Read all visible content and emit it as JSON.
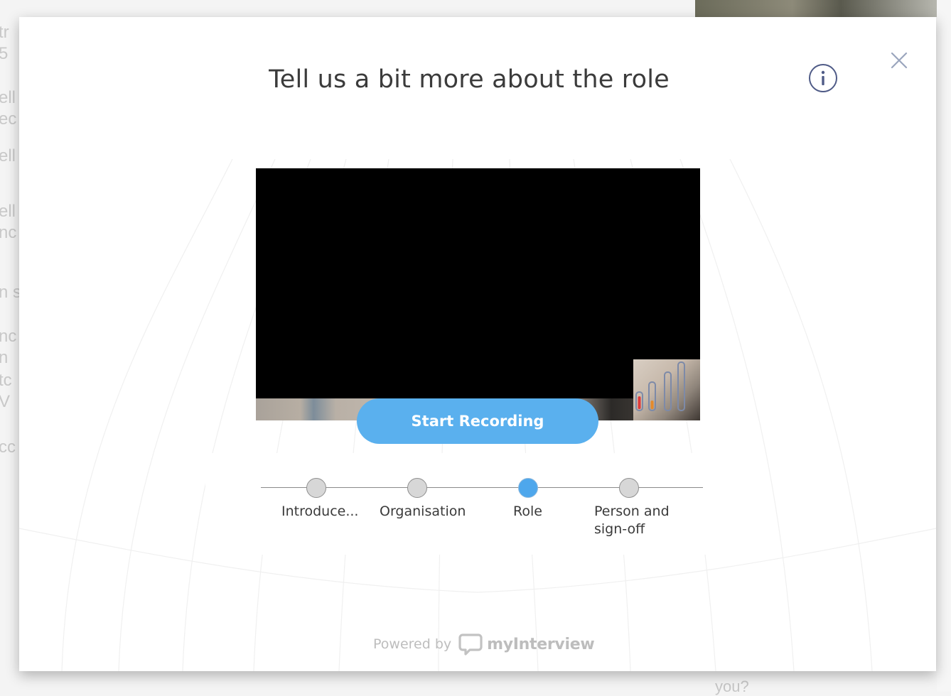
{
  "background": {
    "left_fragments": [
      "tr",
      "5",
      "ell",
      "ec",
      "ell",
      "ell",
      "nc",
      "n s",
      "nc",
      "n",
      "tc",
      "V",
      "cc"
    ],
    "bottom_fragment": "you?"
  },
  "modal": {
    "title": "Tell us a bit more about the role",
    "info_icon": "info-icon",
    "close_icon": "close-icon"
  },
  "recording": {
    "start_label": "Start Recording"
  },
  "steps": [
    {
      "label": "Introduce...",
      "active": false
    },
    {
      "label": "Organisation",
      "active": false
    },
    {
      "label": "Role",
      "active": true
    },
    {
      "label": "Person and\nsign-off",
      "active": false
    }
  ],
  "footer": {
    "powered_by": "Powered by",
    "brand": "myInterview"
  },
  "colors": {
    "accent": "#5ab0ee",
    "active_step": "#4ea7ec",
    "info_icon": "#4f5b87"
  }
}
